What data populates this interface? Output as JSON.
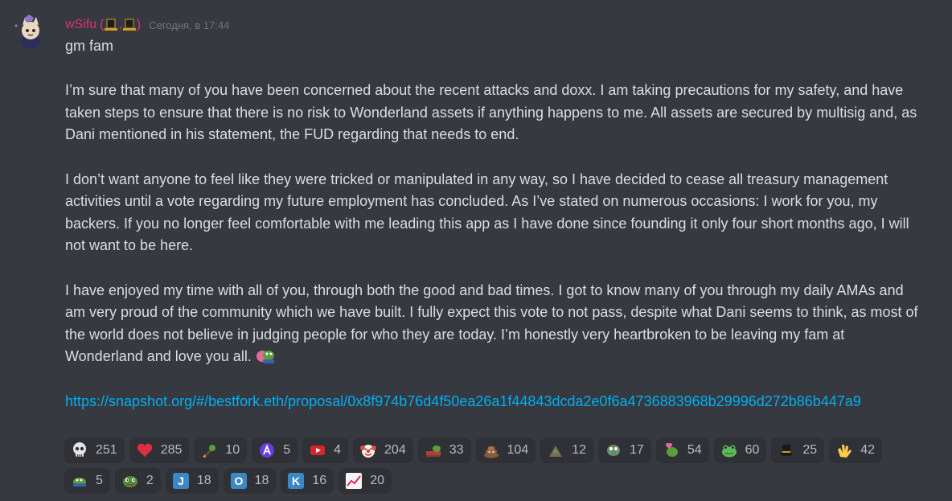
{
  "author": {
    "username": "wSifu",
    "hats_open": "(",
    "hats_sep": ",",
    "hats_close": ")",
    "timestamp": "Сегодня, в 17:44"
  },
  "message": {
    "greeting": "gm fam",
    "para1": "I’m sure that many of you have been concerned about the recent attacks and doxx. I am taking precautions for my safety, and have taken steps to ensure that there is no risk to Wonderland assets if anything happens to me. All assets are secured by multisig and, as Dani mentioned in his statement, the FUD regarding that needs to end.",
    "para2": "I don’t want anyone to feel like they were tricked or manipulated in any way, so I have decided to cease all treasury management activities until a vote regarding my future employment has concluded. As I’ve stated on numerous occasions: I work for you, my backers. If you no longer feel comfortable with me leading this app as I have done since founding it only four short months ago, I will not want to be here.",
    "para3": "I have enjoyed my time with all of you, through both the good and bad times. I got to know many of you through my daily AMAs and am very proud of the community which we have built. I fully expect this vote to not pass, despite what Dani seems to think, as most of the world does not believe in judging people for who they are today. I’m honestly very heartbroken to be leaving my fam at Wonderland and love you all.",
    "para3_emoji": "pepe-hug-emoji",
    "link": "https://snapshot.org/#/bestfork.eth/proposal/0x8f974b76d4f50ea26a1f44843dcda2e0f6a4736883968b29996d272b86b447a9"
  },
  "reactions": [
    {
      "icon": "skull",
      "count": "251"
    },
    {
      "icon": "heart",
      "count": "285"
    },
    {
      "icon": "rocket-pepe",
      "count": "10"
    },
    {
      "icon": "purple-a",
      "count": "5"
    },
    {
      "icon": "red-box",
      "count": "4"
    },
    {
      "icon": "clown",
      "count": "204"
    },
    {
      "icon": "pepe-bed",
      "count": "33"
    },
    {
      "icon": "poop",
      "count": "104"
    },
    {
      "icon": "pile",
      "count": "12"
    },
    {
      "icon": "pepe-cry",
      "count": "17"
    },
    {
      "icon": "pepe-heart",
      "count": "54"
    },
    {
      "icon": "frog",
      "count": "60"
    },
    {
      "icon": "top-hat",
      "count": "25"
    },
    {
      "icon": "clap",
      "count": "42"
    },
    {
      "icon": "pepe-lay",
      "count": "5"
    },
    {
      "icon": "pepe-face",
      "count": "2"
    },
    {
      "icon": "letter-j",
      "count": "18"
    },
    {
      "icon": "letter-o",
      "count": "18"
    },
    {
      "icon": "letter-k",
      "count": "16"
    },
    {
      "icon": "chart-up",
      "count": "20"
    }
  ],
  "colors": {
    "background": "#36393f",
    "username": "#e0336b",
    "link": "#00aff4",
    "reaction_bg": "#2f3136"
  }
}
